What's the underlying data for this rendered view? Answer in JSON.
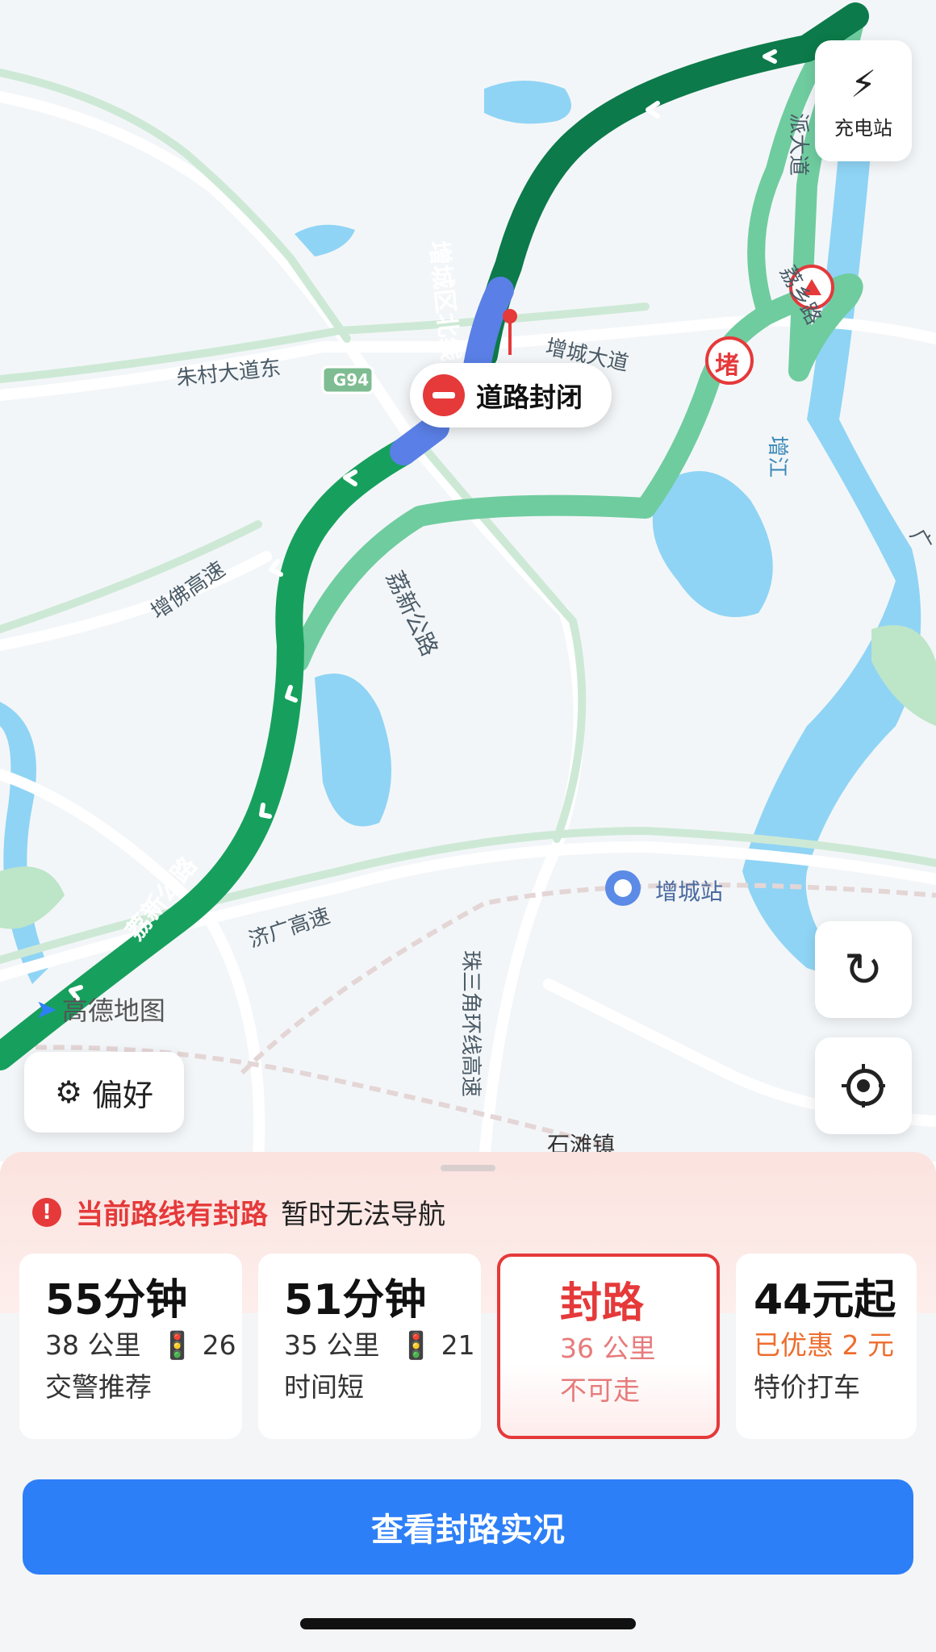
{
  "map": {
    "labels": {
      "zhucun": "朱村大道东",
      "g94": "G94",
      "zengcheng_avenue": "增城大道",
      "zengfo": "增佛高速",
      "lixin_1": "荔新公路",
      "lixin_2": "荔新公路",
      "zengcheng_north": "增城区北线",
      "paitan": "派大道",
      "lixiang": "荔乡路",
      "zengjiang": "增江",
      "jiguang": "济广高速",
      "station": "增城站",
      "pearl_ring": "珠三角环线高速",
      "shitan": "石滩镇",
      "guang": "广"
    },
    "watermark": "高德地图",
    "closure_bubble": "道路封闭",
    "jam_badge": "堵",
    "charging_station": "充电站",
    "preference": "偏好",
    "icons": [
      "charging-icon",
      "refresh-icon",
      "locate-icon",
      "preference-icon",
      "no-entry-icon",
      "construction-icon",
      "train-station-icon",
      "amap-logo-icon"
    ]
  },
  "alert": {
    "title": "当前路线有封路",
    "subtitle": "暂时无法导航"
  },
  "routes": [
    {
      "time": "55分钟",
      "distance": "38 公里",
      "lights": "26",
      "tag": "交警推荐"
    },
    {
      "time": "51分钟",
      "distance": "35 公里",
      "lights": "21",
      "tag": "时间短"
    },
    {
      "time": "封路",
      "distance": "36 公里",
      "tag": "不可走"
    },
    {
      "time": "44元起",
      "discount": "已优惠 2 元",
      "tag": "特价打车"
    }
  ],
  "cta": "查看封路实况",
  "colors": {
    "route_green": "#17a05d",
    "route_dark_green": "#0c7a4a",
    "closed_blue": "#5a7fe6",
    "alert_red": "#e5393a",
    "button_blue": "#2d7ff7",
    "water": "#8fd4f5"
  }
}
